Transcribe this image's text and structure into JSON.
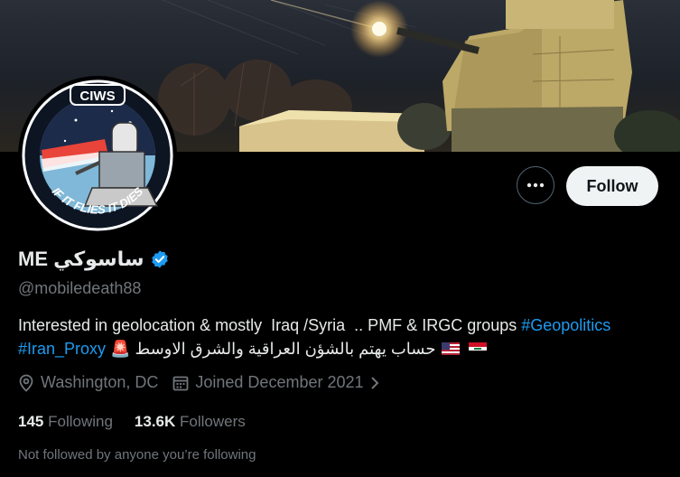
{
  "avatar": {
    "badge_top": "CIWS",
    "badge_bottom": "IF IT FLIES IT DIES"
  },
  "actions": {
    "more_label": "•••",
    "follow_label": "Follow"
  },
  "profile": {
    "display_name": "ساسوكي ME",
    "verified": true,
    "handle": "@mobiledeath88",
    "bio_line1_text": "Interested in geolocation & mostly  Iraq /Syria  .. PMF & IRGC groups ",
    "bio_line1_tag": "#Geopolitics",
    "bio_line2_tag": "#Iran_Proxy",
    "bio_line2_emoji": "🚨",
    "bio_line2_arabic": "حساب يهتم بالشؤن العراقية والشرق الاوسط",
    "bio_line2_flags": [
      "us-flag",
      "iraq-flag"
    ],
    "location": "Washington, DC",
    "joined": "Joined December 2021",
    "following_count": "145",
    "following_label": "Following",
    "followers_count": "13.6K",
    "followers_label": "Followers",
    "not_followed_text": "Not followed by anyone you’re following"
  },
  "colors": {
    "link": "#1d9bf0",
    "muted": "#71767b",
    "text": "#e7e9ea",
    "verified": "#1d9bf0",
    "background": "#000000"
  }
}
